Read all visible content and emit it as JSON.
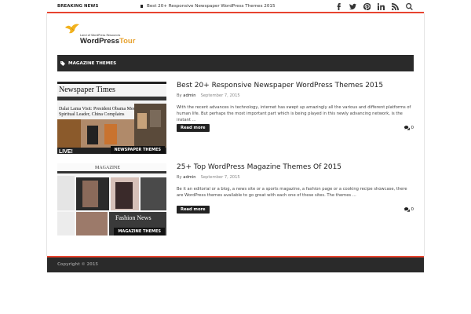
{
  "topbar": {
    "breaking_label": "BREAKING NEWS",
    "breaking_title": "Best 20+ Responsive Newspaper WordPress Themes 2015",
    "social": [
      "facebook-icon",
      "twitter-icon",
      "pinterest-icon",
      "linkedin-icon",
      "rss-icon",
      "search-icon"
    ]
  },
  "logo": {
    "tagline": "Land of WordPress Resources",
    "name_part1": "WordPress",
    "name_part2": "Tour",
    "accent": "#e7a22f"
  },
  "nav": {
    "item_label": "MAGAZINE THEMES"
  },
  "posts": [
    {
      "title": "Best 20+ Responsive Newspaper WordPress Themes 2015",
      "by": "By",
      "author": "admin",
      "date": "September 7, 2015",
      "excerpt": "With the recent advances in technology, internet has swept up amazingly all the various and different platforms of human life. But perhaps the most important part which is being played in this newly advancing network, is the instant ...",
      "read_more": "Read more",
      "comments": "0",
      "thumb_label": "NEWSPAPER THEMES",
      "thumb_headline": "Dalai Lama Visit: President Obama Meets Spiritual Leader, China Complains",
      "thumb_masthead": "Newspaper Times"
    },
    {
      "title": "25+ Top WordPress Magazine Themes Of 2015",
      "by": "By",
      "author": "admin",
      "date": "September 7, 2015",
      "excerpt": "Be it an editorial or a blog, a news site or a sports magazine, a fashion page or a cooking recipe showcase, there are WordPress themes available to go great with each one of these sites. The themes ...",
      "read_more": "Read more",
      "comments": "0",
      "thumb_label": "MAGAZINE THEMES",
      "thumb_headline": "Fashion News"
    }
  ],
  "footer": {
    "copyright": "Copyright © 2015"
  },
  "colors": {
    "accent_red": "#e7442f",
    "dark": "#2a2a2a"
  }
}
